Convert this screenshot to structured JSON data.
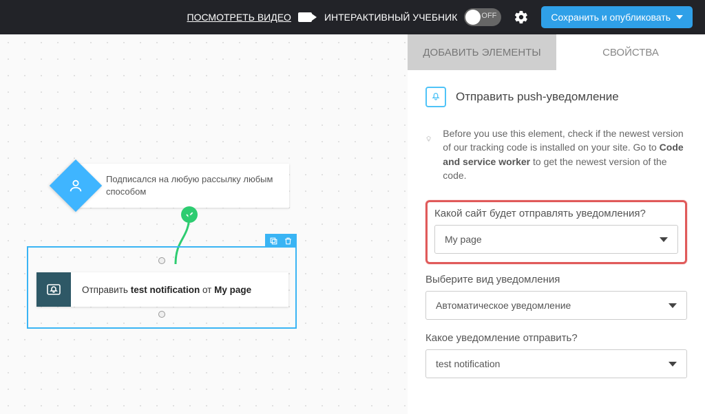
{
  "header": {
    "watch_video": "ПОСМОТРЕТЬ ВИДЕО",
    "tutorial": "ИНТЕРАКТИВНЫЙ УЧЕБНИК",
    "toggle_state": "OFF",
    "publish": "Сохранить и опубликовать"
  },
  "canvas": {
    "trigger_text": "Подписался на любую рассылку любым способом",
    "action_prefix": "Отправить ",
    "action_notif": "test notification",
    "action_mid": " от ",
    "action_site": "My page"
  },
  "panel": {
    "tabs": {
      "add": "ДОБАВИТЬ ЭЛЕМЕНТЫ",
      "props": "СВОЙСТВА"
    },
    "title": "Отправить push-уведомление",
    "hint_before": "Before you use this element, check if the newest version of our tracking code is installed on your site. Go to ",
    "hint_bold": "Code and service worker",
    "hint_after": " to get the newest version of the code.",
    "f1_label": "Какой сайт будет отправлять уведомления?",
    "f1_value": "My page",
    "f2_label": "Выберите вид уведомления",
    "f2_value": "Автоматическое уведомление",
    "f3_label": "Какое уведомление отправить?",
    "f3_value": "test notification"
  }
}
